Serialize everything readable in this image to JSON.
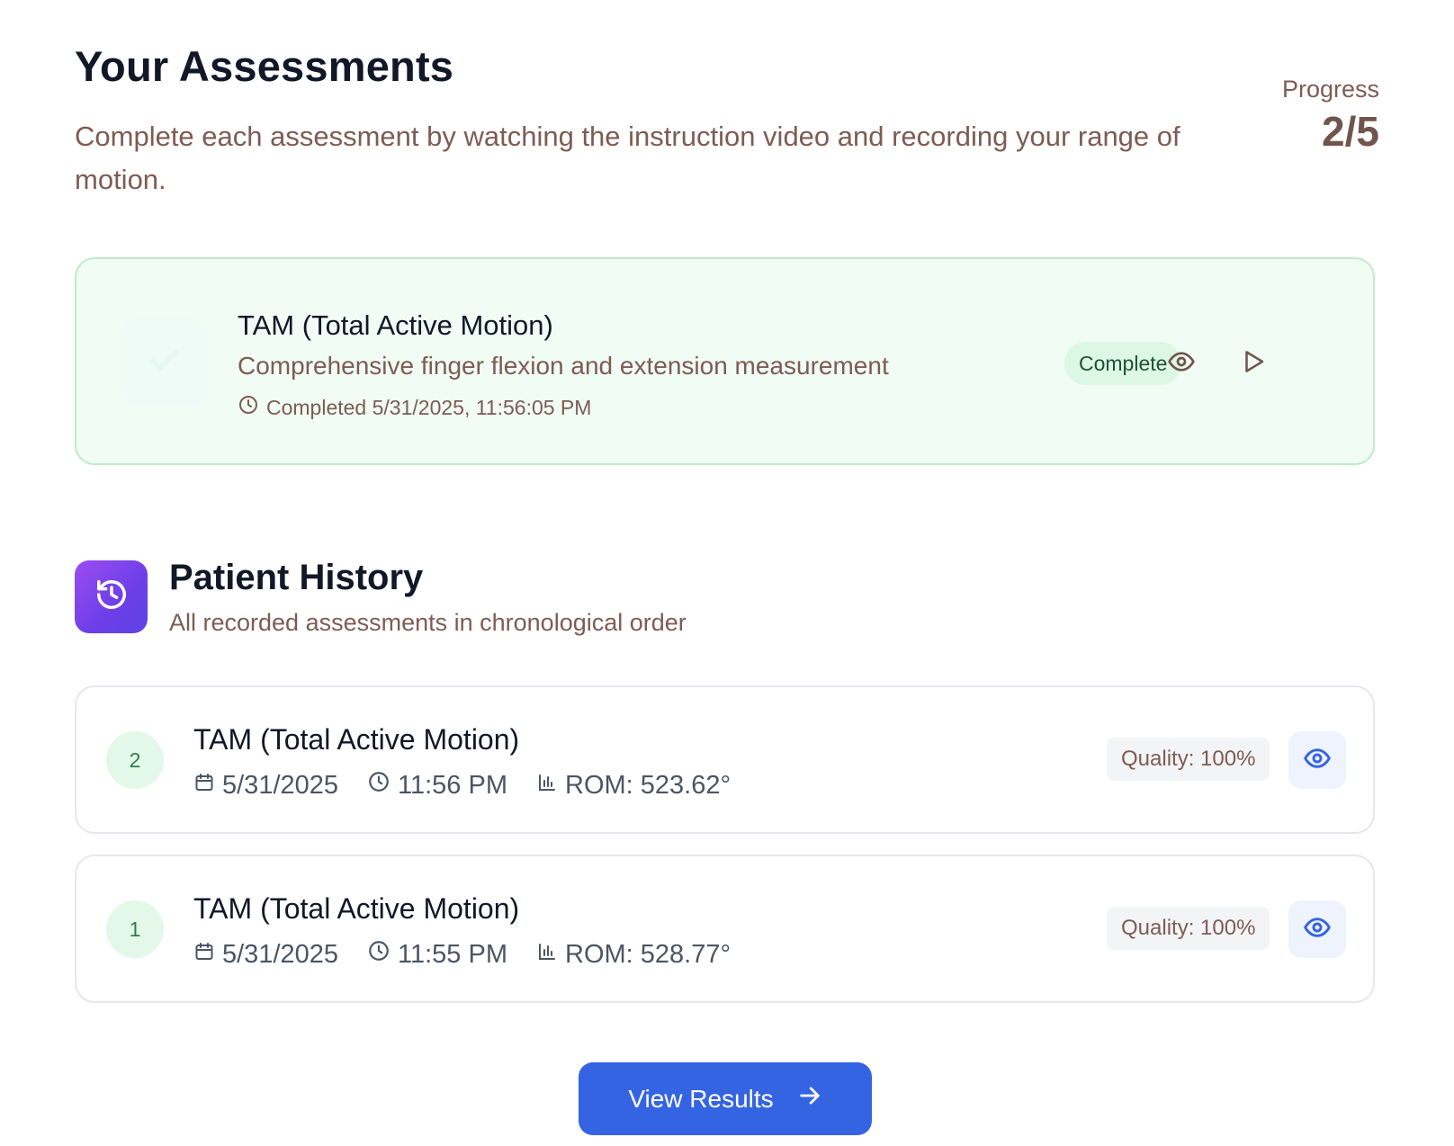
{
  "header": {
    "title": "Your Assessments",
    "subtitle": "Complete each assessment by watching the instruction video and recording your range of motion.",
    "progress_label": "Progress",
    "progress_value": "2/5",
    "progress_completed": 2,
    "progress_total": 5
  },
  "assessment": {
    "title": "TAM (Total Active Motion)",
    "description": "Comprehensive finger flexion and extension measurement",
    "completed_text": "Completed 5/31/2025, 11:56:05 PM",
    "status": "Complete",
    "icons": {
      "status": "check-icon",
      "view": "eye-icon",
      "play": "play-icon",
      "clock": "clock-icon"
    },
    "colors": {
      "card_bg": "#f0fcf4",
      "card_border": "#bdecca",
      "badge_bg": "#dcf7e4"
    }
  },
  "history": {
    "title": "Patient History",
    "subtitle": "All recorded assessments in chronological order",
    "icon": "history-icon",
    "rows": [
      {
        "number": "2",
        "title": "TAM (Total Active Motion)",
        "date": "5/31/2025",
        "time": "11:56 PM",
        "rom": "ROM: 523.62°",
        "quality": "Quality: 100%"
      },
      {
        "number": "1",
        "title": "TAM (Total Active Motion)",
        "date": "5/31/2025",
        "time": "11:55 PM",
        "rom": "ROM: 528.77°",
        "quality": "Quality: 100%"
      }
    ]
  },
  "footer": {
    "view_results_label": "View Results"
  },
  "colors": {
    "accent": "#3564e3",
    "muted_text": "#7d5c54",
    "history_icon_gradient": [
      "#9b4df0",
      "#5d43e6"
    ]
  }
}
